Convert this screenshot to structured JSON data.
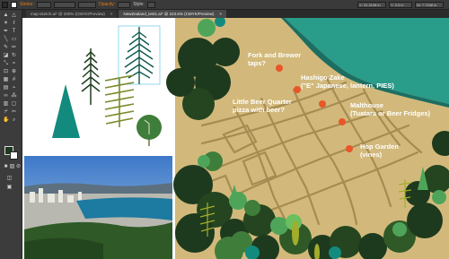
{
  "control_bar": {
    "stroke_label": "Stroke:",
    "opacity_label": "Opacity:",
    "style_label": "Style:",
    "coord_x": "X: 31.3108 in",
    "coord_y": "Y: 3.5 in",
    "width": "W: 7.7948 in"
  },
  "tabs": [
    {
      "label": "map-sketch.ai* @ 200% (CMYK/Preview)",
      "close": "×"
    },
    {
      "label": "NewZealand_test1.ai* @ 223.6% (CMYK/Preview)",
      "close": "×"
    }
  ],
  "map_labels": {
    "fork_brewer": "Fork and Brewer\ntaps?",
    "hashigo": "Hashigo Zake\n(\"E\" Japanese, lantern, PIES)",
    "little_beer": "Little Beer Quarter\npizza with beer?",
    "malthouse": "Malthouse\n(Tuatara or Beer Fridges)",
    "hop_garden": "Hop Garden\n(vines)"
  },
  "colors": {
    "map_land": "#d2b97b",
    "map_sea": "#2a9c8a",
    "pin": "#e8562a",
    "forest_dark": "#1e3a1e",
    "forest_green": "#3f7d3a",
    "teal_tree": "#138a7e"
  }
}
